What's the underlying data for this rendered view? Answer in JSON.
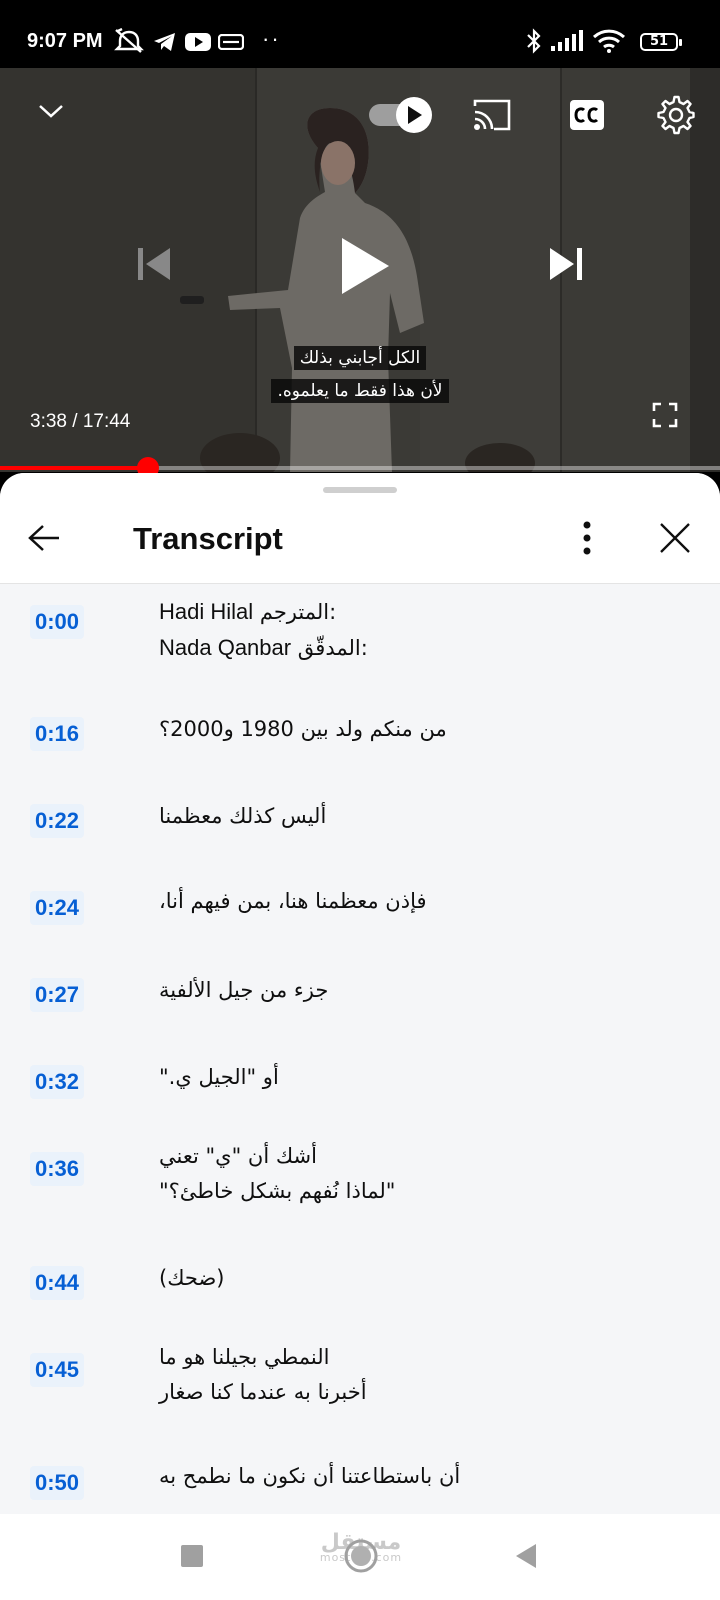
{
  "status_bar": {
    "time": "9:07 PM",
    "dots": "··",
    "battery": "51"
  },
  "player": {
    "current_time": "3:38",
    "separator": " / ",
    "duration": "17:44",
    "progress_fraction": 0.205,
    "subtitle_line1": "الكل أجابني بذلك",
    "subtitle_line2": "لأن هذا فقط ما يعلموه."
  },
  "transcript": {
    "title": "Transcript",
    "segments": [
      {
        "time": "0:00",
        "line1_name": "Hadi Hilal",
        "line1_label": "المترجم:",
        "line2_name": "Nada Qanbar",
        "line2_label": "المدقّق:"
      },
      {
        "time": "0:16",
        "text": "من منكم ولد بين 1980 و2000؟"
      },
      {
        "time": "0:22",
        "text": "أليس كذلك معظمنا"
      },
      {
        "time": "0:24",
        "text": "فإذن معظمنا هنا، بمن فيهم أنا،"
      },
      {
        "time": "0:27",
        "text": "جزء من جيل الألفية"
      },
      {
        "time": "0:32",
        "text": "أو \"الجيل ي.\""
      },
      {
        "time": "0:36",
        "line1": "أشك أن \"ي\" تعني",
        "line2": "\"لماذا نُفهم بشكل خاطئ؟\""
      },
      {
        "time": "0:44",
        "text": "(ضحك)"
      },
      {
        "time": "0:45",
        "line1": "النمطي بجيلنا هو ما",
        "line2": "أخبرنا به عندما كنا صغار"
      },
      {
        "time": "0:50",
        "text": "أن باستطاعتنا أن نكون ما نطمح به"
      }
    ]
  },
  "watermark": {
    "logo_text": "مستقل",
    "domain": "mostaql.com"
  },
  "colors": {
    "accent_red": "#ff0000",
    "timestamp_blue": "#065fd4"
  }
}
